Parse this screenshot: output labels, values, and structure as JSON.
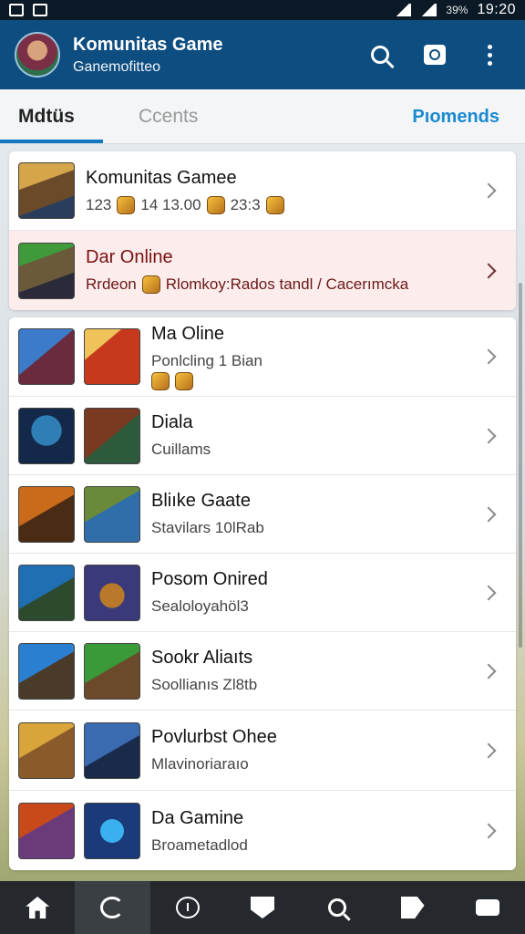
{
  "status_bar": {
    "battery": "39%",
    "time": "19:20"
  },
  "app_bar": {
    "title": "Komunitas Game",
    "subtitle": "Ganemofitteo",
    "icons": [
      "search-icon",
      "camera-icon",
      "more-vert-icon"
    ]
  },
  "tabs": [
    {
      "label": "Mdtüs",
      "active": true
    },
    {
      "label": "Ccents",
      "active": false
    },
    {
      "label": "Pıomends",
      "active": false
    }
  ],
  "top_card": [
    {
      "title": "Komunitas Gamee",
      "stats": [
        "123",
        "14 13.00",
        "23:3"
      ],
      "thumb_colors": [
        "#b8862d",
        "#2a3d5c"
      ]
    },
    {
      "title": "Dar Online",
      "subtitle": "Rrdeon",
      "subtitle_rest": "Rlomkoy:Rados tandl / Cacerımcka",
      "highlight": true,
      "thumb_colors": [
        "#3f9a3c",
        "#2a2a3a"
      ]
    }
  ],
  "list": [
    {
      "title": "Ma Oline",
      "subtitle": "Ponlcling 1 Bian",
      "thumbs": [
        [
          "#3c7bc9",
          "#6a2b3f"
        ],
        [
          "#c7391d",
          "#f0c35a"
        ]
      ],
      "coins": true
    },
    {
      "title": "Diala",
      "subtitle": "Cuillams",
      "thumbs": [
        [
          "#14294a",
          "#2f7fb6"
        ],
        [
          "#7a3a22",
          "#2c5a3a"
        ]
      ]
    },
    {
      "title": "Bliıke Gaate",
      "subtitle": "Stavilars 10lRab",
      "thumbs": [
        [
          "#c96b1a",
          "#4a2b14"
        ],
        [
          "#2f6ea8",
          "#6a8a3a"
        ]
      ]
    },
    {
      "title": "Posom Onired",
      "subtitle": "Sealoloyahöl3",
      "thumbs": [
        [
          "#1f6fb2",
          "#2e4a2e"
        ],
        [
          "#3a3a7a",
          "#b87a2a"
        ]
      ]
    },
    {
      "title": "Sookr Aliaıts",
      "subtitle": "Soollianıs Zl8tb",
      "thumbs": [
        [
          "#2a7fd0",
          "#4a3a2a"
        ],
        [
          "#3a9a3a",
          "#6a4a2a"
        ]
      ]
    },
    {
      "title": "Povlurbst Ohee",
      "subtitle": "Mlavinoriaraıo",
      "thumbs": [
        [
          "#8a5a2a",
          "#d9a53a"
        ],
        [
          "#3a6ab0",
          "#1a2a4a"
        ]
      ]
    },
    {
      "title": "Da Gamine",
      "subtitle": "Broametadlod",
      "thumbs": [
        [
          "#c8491a",
          "#6a3a7a"
        ],
        [
          "#1a3a7a",
          "#3ab0f0"
        ]
      ]
    }
  ],
  "bottom_nav": [
    {
      "icon": "home-icon",
      "active": false
    },
    {
      "icon": "refresh-icon",
      "active": true
    },
    {
      "icon": "info-icon",
      "active": false
    },
    {
      "icon": "shield-icon",
      "active": false
    },
    {
      "icon": "search-icon",
      "active": false
    },
    {
      "icon": "tag-icon",
      "active": false
    },
    {
      "icon": "card-icon",
      "active": false
    }
  ]
}
